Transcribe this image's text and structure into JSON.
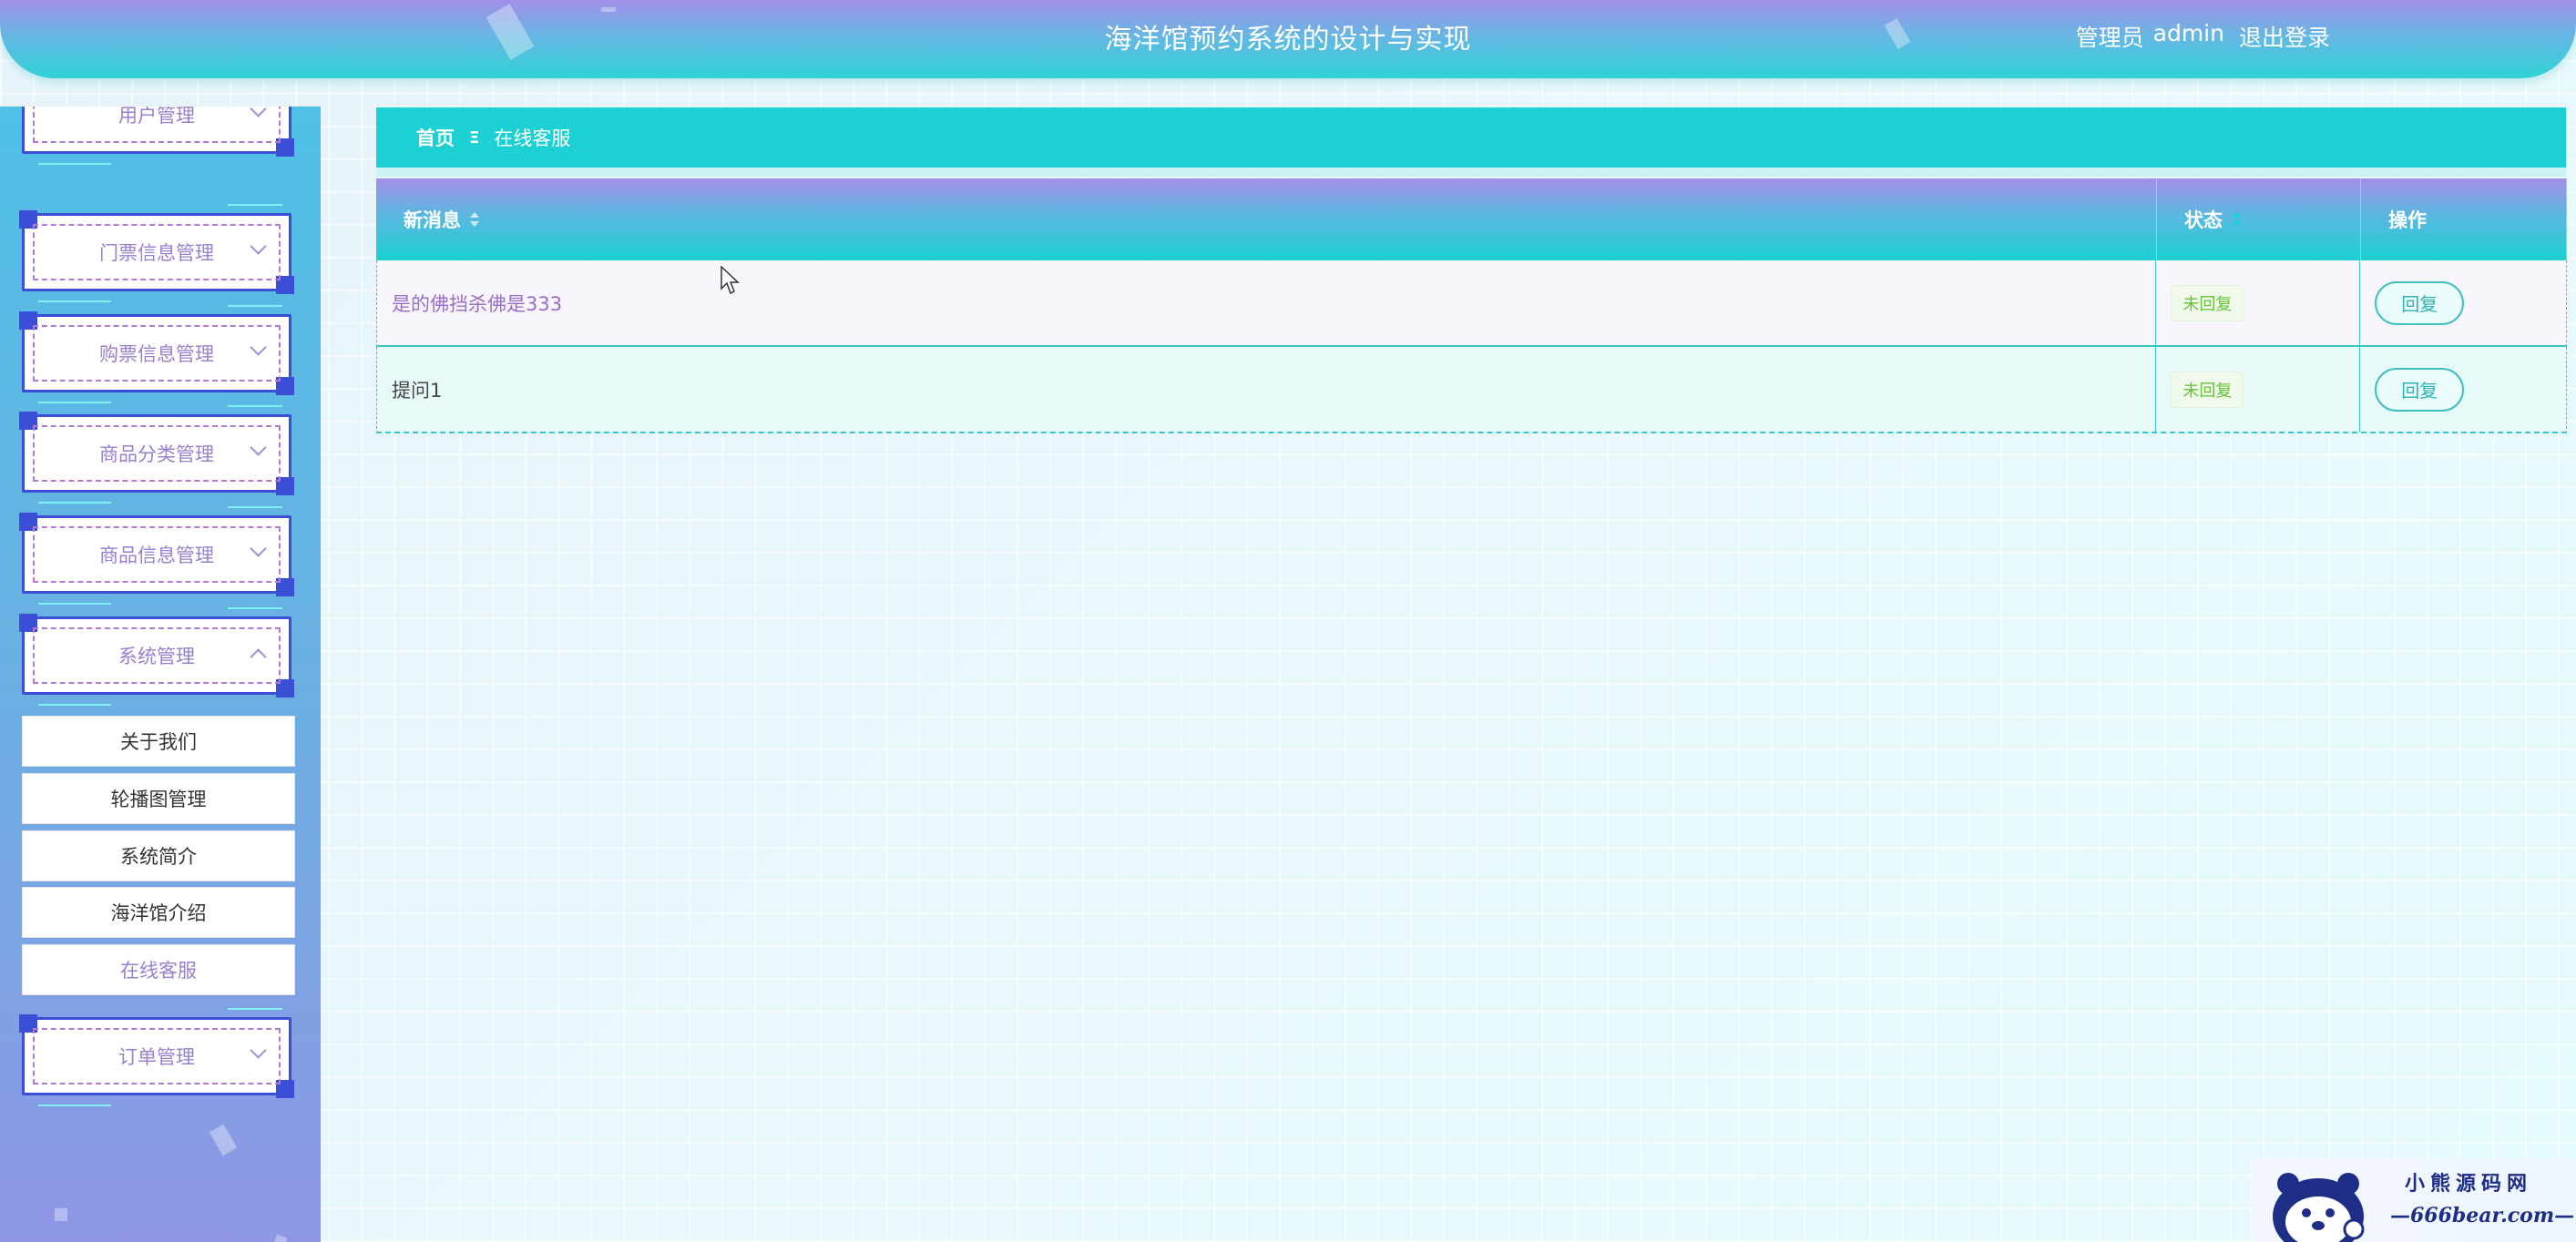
{
  "header": {
    "title": "海洋馆预约系统的设计与实现",
    "role": "管理员",
    "username": "admin",
    "logout_label": "退出登录"
  },
  "sidebar": {
    "menus": [
      {
        "label": "用户管理",
        "expanded": false
      },
      {
        "label": "门票信息管理",
        "expanded": false
      },
      {
        "label": "购票信息管理",
        "expanded": false
      },
      {
        "label": "商品分类管理",
        "expanded": false
      },
      {
        "label": "商品信息管理",
        "expanded": false
      },
      {
        "label": "系统管理",
        "expanded": true
      },
      {
        "label": "订单管理",
        "expanded": false
      }
    ],
    "submenu": [
      {
        "label": "关于我们"
      },
      {
        "label": "轮播图管理"
      },
      {
        "label": "系统简介"
      },
      {
        "label": "海洋馆介绍"
      },
      {
        "label": "在线客服",
        "active": true
      }
    ]
  },
  "breadcrumb": {
    "home": "首页",
    "separator": "Ξ",
    "current": "在线客服"
  },
  "table": {
    "columns": [
      "新消息",
      "状态",
      "操作"
    ],
    "rows": [
      {
        "message": "是的佛挡杀佛是333",
        "status": "未回复",
        "action": "回复"
      },
      {
        "message": "提问1",
        "status": "未回复",
        "action": "回复"
      }
    ]
  },
  "watermark": {
    "name": "小熊源码网",
    "site": "—666bear.com—"
  },
  "colors": {
    "accent": "#1dd0d3",
    "purple": "#a48ee8",
    "menu_border": "#3a4fd6"
  }
}
